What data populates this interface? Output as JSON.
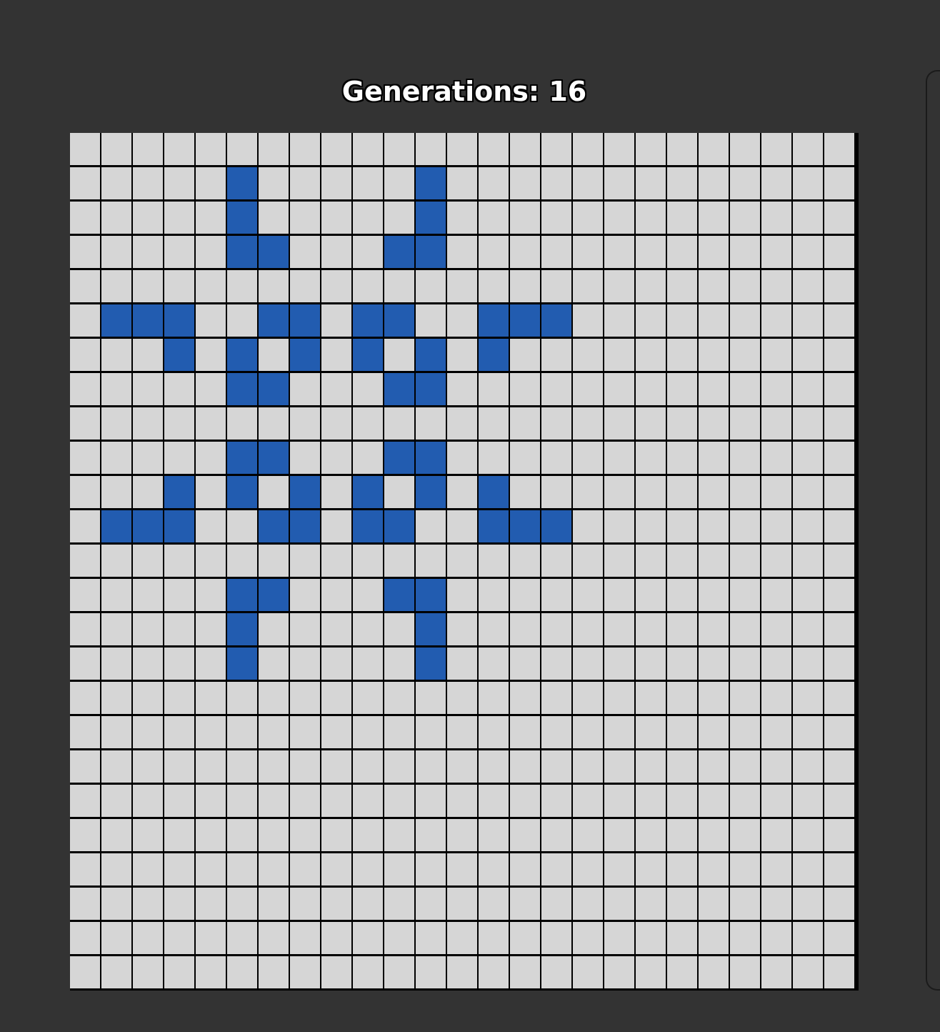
{
  "header": {
    "title": "Generations: 16"
  },
  "board": {
    "rows": 25,
    "cols": 25,
    "alive_color": "#225cb0",
    "dead_color": "#d6d6d6",
    "alive_cells": [
      [
        1,
        5
      ],
      [
        1,
        11
      ],
      [
        2,
        5
      ],
      [
        2,
        11
      ],
      [
        3,
        5
      ],
      [
        3,
        6
      ],
      [
        3,
        10
      ],
      [
        3,
        11
      ],
      [
        5,
        1
      ],
      [
        5,
        2
      ],
      [
        5,
        3
      ],
      [
        5,
        6
      ],
      [
        5,
        7
      ],
      [
        5,
        9
      ],
      [
        5,
        10
      ],
      [
        5,
        13
      ],
      [
        5,
        14
      ],
      [
        5,
        15
      ],
      [
        6,
        3
      ],
      [
        6,
        5
      ],
      [
        6,
        7
      ],
      [
        6,
        9
      ],
      [
        6,
        11
      ],
      [
        6,
        13
      ],
      [
        7,
        5
      ],
      [
        7,
        6
      ],
      [
        7,
        10
      ],
      [
        7,
        11
      ],
      [
        9,
        5
      ],
      [
        9,
        6
      ],
      [
        9,
        10
      ],
      [
        9,
        11
      ],
      [
        10,
        3
      ],
      [
        10,
        5
      ],
      [
        10,
        7
      ],
      [
        10,
        9
      ],
      [
        10,
        11
      ],
      [
        10,
        13
      ],
      [
        11,
        1
      ],
      [
        11,
        2
      ],
      [
        11,
        3
      ],
      [
        11,
        6
      ],
      [
        11,
        7
      ],
      [
        11,
        9
      ],
      [
        11,
        10
      ],
      [
        11,
        13
      ],
      [
        11,
        14
      ],
      [
        11,
        15
      ],
      [
        13,
        5
      ],
      [
        13,
        6
      ],
      [
        13,
        10
      ],
      [
        13,
        11
      ],
      [
        14,
        5
      ],
      [
        14,
        11
      ],
      [
        15,
        5
      ],
      [
        15,
        11
      ]
    ]
  }
}
